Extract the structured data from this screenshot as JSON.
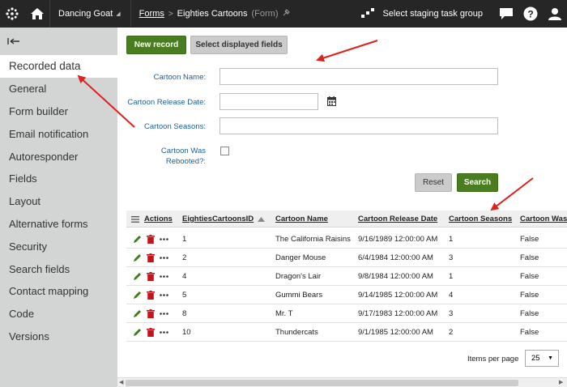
{
  "topbar": {
    "site_name": "Dancing Goat",
    "breadcrumb_link": "Forms",
    "breadcrumb_separator": ">",
    "breadcrumb_current": "Eighties Cartoons",
    "breadcrumb_type": "(Form)",
    "staging_label": "Select staging task group"
  },
  "sidebar": {
    "items": [
      {
        "label": "Recorded data"
      },
      {
        "label": "General"
      },
      {
        "label": "Form builder"
      },
      {
        "label": "Email notification"
      },
      {
        "label": "Autoresponder"
      },
      {
        "label": "Fields"
      },
      {
        "label": "Layout"
      },
      {
        "label": "Alternative forms"
      },
      {
        "label": "Security"
      },
      {
        "label": "Search fields"
      },
      {
        "label": "Contact mapping"
      },
      {
        "label": "Code"
      },
      {
        "label": "Versions"
      }
    ]
  },
  "toolbar": {
    "new_record": "New record",
    "select_fields": "Select displayed fields"
  },
  "filter": {
    "name_label": "Cartoon Name:",
    "date_label": "Cartoon Release Date:",
    "seasons_label": "Cartoon Seasons:",
    "rebooted_label_1": "Cartoon Was",
    "rebooted_label_2": "Rebooted?:",
    "name_value": "",
    "date_value": "",
    "seasons_value": "",
    "reset": "Reset",
    "search": "Search"
  },
  "grid": {
    "columns": [
      "Actions",
      "EightiesCartoonsID",
      "Cartoon Name",
      "Cartoon Release Date",
      "Cartoon Seasons",
      "Cartoon Was"
    ],
    "rows": [
      {
        "id": "1",
        "name": "The California Raisins",
        "date": "9/16/1989 12:00:00 AM",
        "seasons": "1",
        "rebooted": "False"
      },
      {
        "id": "2",
        "name": "Danger Mouse",
        "date": "6/4/1984 12:00:00 AM",
        "seasons": "3",
        "rebooted": "False"
      },
      {
        "id": "4",
        "name": "Dragon's Lair",
        "date": "9/8/1984 12:00:00 AM",
        "seasons": "1",
        "rebooted": "False"
      },
      {
        "id": "5",
        "name": "Gummi Bears",
        "date": "9/14/1985 12:00:00 AM",
        "seasons": "4",
        "rebooted": "False"
      },
      {
        "id": "8",
        "name": "Mr. T",
        "date": "9/17/1983 12:00:00 AM",
        "seasons": "3",
        "rebooted": "False"
      },
      {
        "id": "10",
        "name": "Thundercats",
        "date": "9/1/1985 12:00:00 AM",
        "seasons": "2",
        "rebooted": "False"
      }
    ]
  },
  "footer": {
    "items_per_page_label": "Items per page",
    "items_per_page_value": "25"
  },
  "colors": {
    "topbar": "#262626",
    "sidebar": "#d3d5d4",
    "green_button": "#497d1f",
    "label_blue": "#1f5f99",
    "annotation_red": "#e0201c",
    "delete_red": "#c4141b",
    "edit_green": "#3c7d1c"
  },
  "icons": [
    "kentico-logo-icon",
    "home-icon",
    "staging-icon",
    "chat-icon",
    "help-icon",
    "user-icon",
    "calendar-icon",
    "edit-icon",
    "delete-icon",
    "more-icon",
    "menu-icon",
    "sort-asc-icon",
    "back-arrow-icon"
  ]
}
